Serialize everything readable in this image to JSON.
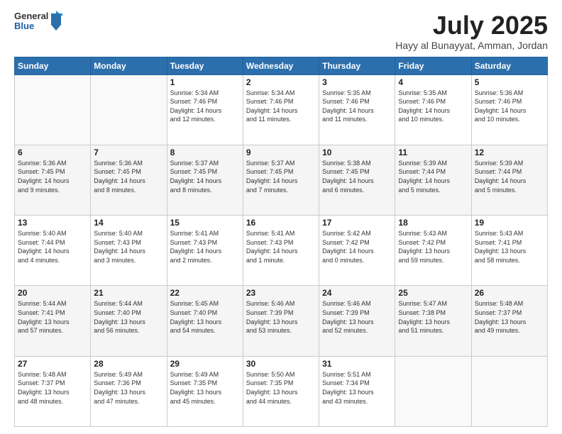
{
  "header": {
    "logo_general": "General",
    "logo_blue": "Blue",
    "title": "July 2025",
    "location": "Hayy al Bunayyat, Amman, Jordan"
  },
  "weekdays": [
    "Sunday",
    "Monday",
    "Tuesday",
    "Wednesday",
    "Thursday",
    "Friday",
    "Saturday"
  ],
  "weeks": [
    [
      {
        "day": "",
        "info": ""
      },
      {
        "day": "",
        "info": ""
      },
      {
        "day": "1",
        "info": "Sunrise: 5:34 AM\nSunset: 7:46 PM\nDaylight: 14 hours\nand 12 minutes."
      },
      {
        "day": "2",
        "info": "Sunrise: 5:34 AM\nSunset: 7:46 PM\nDaylight: 14 hours\nand 11 minutes."
      },
      {
        "day": "3",
        "info": "Sunrise: 5:35 AM\nSunset: 7:46 PM\nDaylight: 14 hours\nand 11 minutes."
      },
      {
        "day": "4",
        "info": "Sunrise: 5:35 AM\nSunset: 7:46 PM\nDaylight: 14 hours\nand 10 minutes."
      },
      {
        "day": "5",
        "info": "Sunrise: 5:36 AM\nSunset: 7:46 PM\nDaylight: 14 hours\nand 10 minutes."
      }
    ],
    [
      {
        "day": "6",
        "info": "Sunrise: 5:36 AM\nSunset: 7:45 PM\nDaylight: 14 hours\nand 9 minutes."
      },
      {
        "day": "7",
        "info": "Sunrise: 5:36 AM\nSunset: 7:45 PM\nDaylight: 14 hours\nand 8 minutes."
      },
      {
        "day": "8",
        "info": "Sunrise: 5:37 AM\nSunset: 7:45 PM\nDaylight: 14 hours\nand 8 minutes."
      },
      {
        "day": "9",
        "info": "Sunrise: 5:37 AM\nSunset: 7:45 PM\nDaylight: 14 hours\nand 7 minutes."
      },
      {
        "day": "10",
        "info": "Sunrise: 5:38 AM\nSunset: 7:45 PM\nDaylight: 14 hours\nand 6 minutes."
      },
      {
        "day": "11",
        "info": "Sunrise: 5:39 AM\nSunset: 7:44 PM\nDaylight: 14 hours\nand 5 minutes."
      },
      {
        "day": "12",
        "info": "Sunrise: 5:39 AM\nSunset: 7:44 PM\nDaylight: 14 hours\nand 5 minutes."
      }
    ],
    [
      {
        "day": "13",
        "info": "Sunrise: 5:40 AM\nSunset: 7:44 PM\nDaylight: 14 hours\nand 4 minutes."
      },
      {
        "day": "14",
        "info": "Sunrise: 5:40 AM\nSunset: 7:43 PM\nDaylight: 14 hours\nand 3 minutes."
      },
      {
        "day": "15",
        "info": "Sunrise: 5:41 AM\nSunset: 7:43 PM\nDaylight: 14 hours\nand 2 minutes."
      },
      {
        "day": "16",
        "info": "Sunrise: 5:41 AM\nSunset: 7:43 PM\nDaylight: 14 hours\nand 1 minute."
      },
      {
        "day": "17",
        "info": "Sunrise: 5:42 AM\nSunset: 7:42 PM\nDaylight: 14 hours\nand 0 minutes."
      },
      {
        "day": "18",
        "info": "Sunrise: 5:43 AM\nSunset: 7:42 PM\nDaylight: 13 hours\nand 59 minutes."
      },
      {
        "day": "19",
        "info": "Sunrise: 5:43 AM\nSunset: 7:41 PM\nDaylight: 13 hours\nand 58 minutes."
      }
    ],
    [
      {
        "day": "20",
        "info": "Sunrise: 5:44 AM\nSunset: 7:41 PM\nDaylight: 13 hours\nand 57 minutes."
      },
      {
        "day": "21",
        "info": "Sunrise: 5:44 AM\nSunset: 7:40 PM\nDaylight: 13 hours\nand 56 minutes."
      },
      {
        "day": "22",
        "info": "Sunrise: 5:45 AM\nSunset: 7:40 PM\nDaylight: 13 hours\nand 54 minutes."
      },
      {
        "day": "23",
        "info": "Sunrise: 5:46 AM\nSunset: 7:39 PM\nDaylight: 13 hours\nand 53 minutes."
      },
      {
        "day": "24",
        "info": "Sunrise: 5:46 AM\nSunset: 7:39 PM\nDaylight: 13 hours\nand 52 minutes."
      },
      {
        "day": "25",
        "info": "Sunrise: 5:47 AM\nSunset: 7:38 PM\nDaylight: 13 hours\nand 51 minutes."
      },
      {
        "day": "26",
        "info": "Sunrise: 5:48 AM\nSunset: 7:37 PM\nDaylight: 13 hours\nand 49 minutes."
      }
    ],
    [
      {
        "day": "27",
        "info": "Sunrise: 5:48 AM\nSunset: 7:37 PM\nDaylight: 13 hours\nand 48 minutes."
      },
      {
        "day": "28",
        "info": "Sunrise: 5:49 AM\nSunset: 7:36 PM\nDaylight: 13 hours\nand 47 minutes."
      },
      {
        "day": "29",
        "info": "Sunrise: 5:49 AM\nSunset: 7:35 PM\nDaylight: 13 hours\nand 45 minutes."
      },
      {
        "day": "30",
        "info": "Sunrise: 5:50 AM\nSunset: 7:35 PM\nDaylight: 13 hours\nand 44 minutes."
      },
      {
        "day": "31",
        "info": "Sunrise: 5:51 AM\nSunset: 7:34 PM\nDaylight: 13 hours\nand 43 minutes."
      },
      {
        "day": "",
        "info": ""
      },
      {
        "day": "",
        "info": ""
      }
    ]
  ]
}
